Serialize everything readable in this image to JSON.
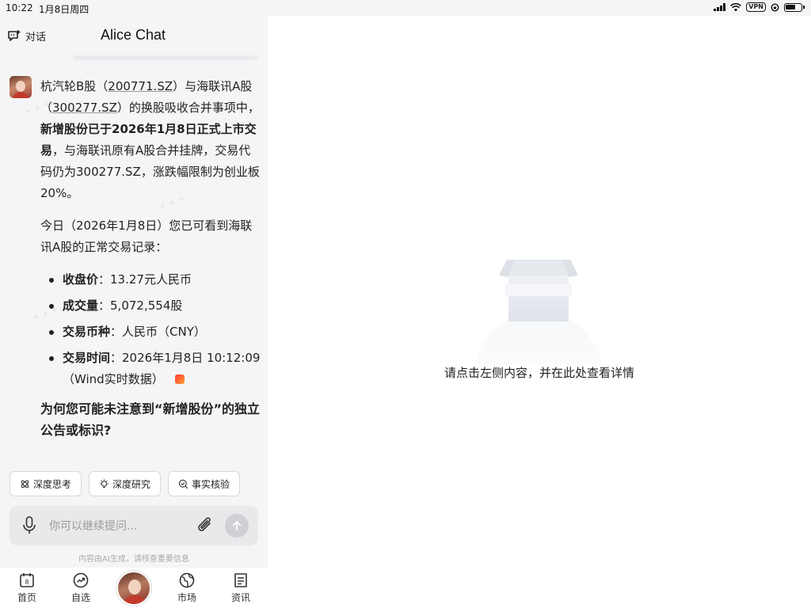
{
  "status_bar": {
    "time": "10:22",
    "date": "1月8日周四",
    "vpn": "VPN"
  },
  "header": {
    "conversation_label": "对话",
    "app_title": "Alice Chat"
  },
  "message": {
    "p1_parts": [
      "杭汽轮B股（",
      "200771.SZ",
      "）与海联讯A股（",
      "300277.SZ",
      "）的换股吸收合并事项中，",
      "新增股份已于2026年1月8日正式上市交易",
      "，与海联讯原有A股合并挂牌，交易代码仍为300277.SZ，涨跌幅限制为创业板20%。"
    ],
    "p2": "今日（2026年1月8日）您已可看到海联讯A股的正常交易记录：",
    "bullets": [
      {
        "label": "收盘价",
        "value": "：13.27元人民币"
      },
      {
        "label": "成交量",
        "value": "：5,072,554股"
      },
      {
        "label": "交易币种",
        "value": "：人民币（CNY）"
      },
      {
        "label": "交易时间",
        "value": "：2026年1月8日 10:12:09（Wind实时数据）"
      }
    ],
    "question": "为何您可能未注意到“新增股份”的独立公告或标识?"
  },
  "chips": {
    "deep_think": "深度思考",
    "deep_research": "深度研究",
    "fact_check": "事实核验"
  },
  "input": {
    "placeholder": "你可以继续提问..."
  },
  "disclaimer": "内容由AI生成，请核查重要信息",
  "nav": {
    "home": "首页",
    "home_day": "8",
    "watchlist": "自选",
    "market": "市场",
    "news": "资讯"
  },
  "right_pane": {
    "empty_text": "请点击左侧内容，并在此处查看详情"
  }
}
